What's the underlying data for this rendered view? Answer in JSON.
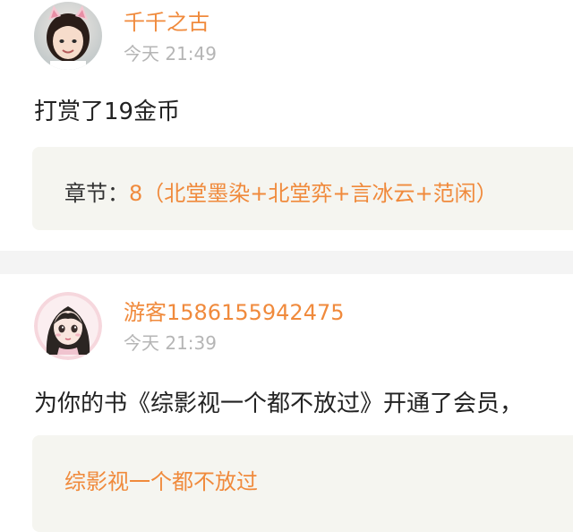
{
  "colors": {
    "accent": "#f08a3c",
    "time": "#b5b5b5",
    "text": "#222222",
    "card_bg": "#f5f5f0",
    "divider": "#f4f4f4"
  },
  "posts": [
    {
      "avatar": "girl-photo-avatar",
      "username": "千千之古",
      "time": "今天 21:49",
      "message": "打赏了19金币",
      "card": {
        "label": "章节：",
        "value": "8（北堂墨染+北堂弈+言冰云+范闲）"
      }
    },
    {
      "avatar": "cartoon-girl-avatar",
      "username": "游客1586155942475",
      "time": "今天 21:39",
      "message": "为你的书《综影视一个都不放过》开通了会员，",
      "card": {
        "value": "综影视一个都不放过"
      }
    }
  ]
}
